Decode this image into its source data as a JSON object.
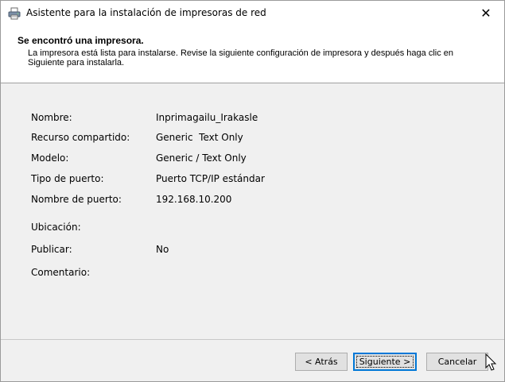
{
  "window": {
    "title": "Asistente para la instalación de impresoras de red",
    "close_glyph": "✕"
  },
  "header": {
    "title": "Se encontró una impresora.",
    "description": "La impresora está lista para instalarse. Revise la siguiente configuración de impresora y después haga clic en Siguiente para instalarla."
  },
  "details": [
    {
      "label": "Nombre:",
      "value": "Inprimagailu_Irakasle"
    },
    {
      "label": "Recurso compartido:",
      "value": "Generic  Text Only"
    },
    {
      "label": "Modelo:",
      "value": "Generic / Text Only"
    },
    {
      "label": "Tipo de puerto:",
      "value": "Puerto TCP/IP estándar"
    },
    {
      "label": "Nombre de puerto:",
      "value": "192.168.10.200"
    },
    {
      "label": "Ubicación:",
      "value": ""
    },
    {
      "label": "Publicar:",
      "value": "No"
    },
    {
      "label": "Comentario:",
      "value": ""
    }
  ],
  "buttons": {
    "back_label": "< Atrás",
    "next_label": "Siguiente >",
    "cancel_label": "Cancelar"
  },
  "icons": {
    "title_icon": "printer-icon",
    "cursor": "mouse-pointer-icon"
  },
  "colors": {
    "accent": "#0078d7",
    "body_bg": "#f0f0f0",
    "button_bg": "#e1e1e1"
  }
}
